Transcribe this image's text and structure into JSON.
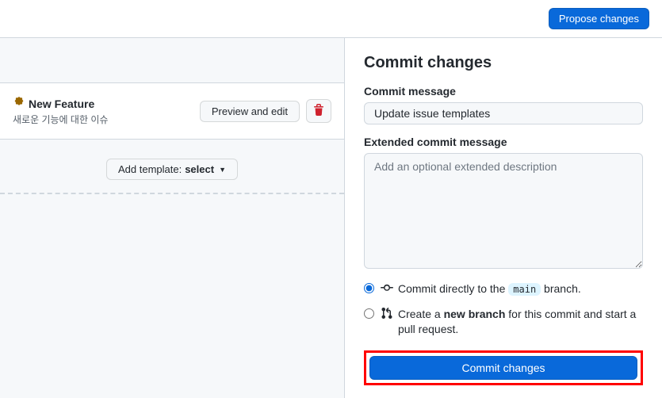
{
  "topbar": {
    "propose_label": "Propose changes"
  },
  "template": {
    "title": "New Feature",
    "description": "새로운 기능에 대한 이슈",
    "preview_label": "Preview and edit"
  },
  "add_template": {
    "prefix": "Add template: ",
    "select": "select"
  },
  "commit_panel": {
    "heading": "Commit changes",
    "message_label": "Commit message",
    "message_value": "Update issue templates",
    "extended_label": "Extended commit message",
    "extended_placeholder": "Add an optional extended description",
    "radio_direct_prefix": "Commit directly to the ",
    "radio_direct_branch": "main",
    "radio_direct_suffix": " branch.",
    "radio_newbranch_prefix": "Create a ",
    "radio_newbranch_bold": "new branch",
    "radio_newbranch_suffix": " for this commit and start a pull request.",
    "commit_button": "Commit changes"
  }
}
